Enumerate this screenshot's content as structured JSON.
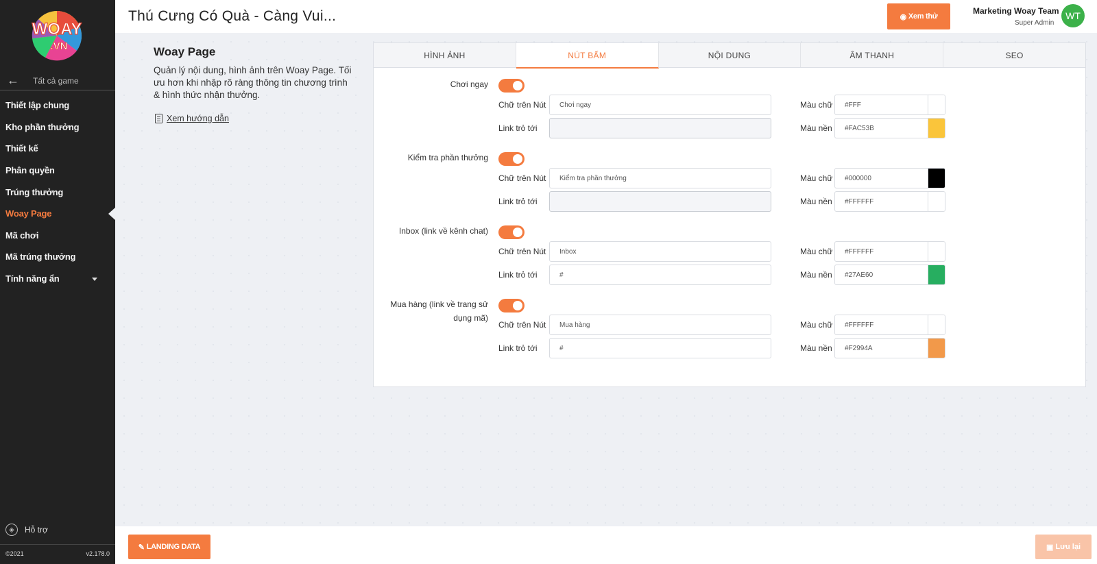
{
  "sidebar": {
    "logo_text": "WOAY",
    "logo_sub": ".VN",
    "back_label": "Tất cả game",
    "items": [
      {
        "label": "Thiết lập chung"
      },
      {
        "label": "Kho phần thưởng"
      },
      {
        "label": "Thiết kế"
      },
      {
        "label": "Phân quyền"
      },
      {
        "label": "Trúng thưởng"
      },
      {
        "label": "Woay Page"
      },
      {
        "label": "Mã chơi"
      },
      {
        "label": "Mã trúng thưởng"
      },
      {
        "label": "Tính năng ẩn"
      }
    ],
    "active_item": "Woay Page",
    "support_label": "Hỗ trợ",
    "copyright": "©2021",
    "version": "v2.178.0"
  },
  "header": {
    "title": "Thú Cưng Có Quà - Càng Vui...",
    "preview_label": "Xem thử",
    "user_name": "Marketing Woay Team",
    "user_role": "Super Admin",
    "avatar_initials": "WT"
  },
  "intro": {
    "title": "Woay Page",
    "description": "Quản lý nội dung, hình ảnh trên Woay Page. Tối ưu hơn khi nhập rõ ràng thông tin chương trình & hình thức nhận thưởng.",
    "guide_link": "Xem hướng dẫn"
  },
  "tabs": [
    {
      "label": "HÌNH ẢNH"
    },
    {
      "label": "NÚT BẤM"
    },
    {
      "label": "NỘI DUNG"
    },
    {
      "label": "ÂM THANH"
    },
    {
      "label": "SEO"
    }
  ],
  "active_tab": "NÚT BẤM",
  "field_labels": {
    "button_text": "Chữ trên Nút",
    "link": "Link trỏ tới",
    "text_color": "Màu chữ",
    "bg_color": "Màu nền"
  },
  "button_groups": [
    {
      "label": "Chơi ngay",
      "enabled": true,
      "button_text": "Chơi ngay",
      "link": "",
      "link_readonly": true,
      "text_color": "#FFF",
      "bg_color": "#FAC53B"
    },
    {
      "label": "Kiểm tra phần thưởng",
      "enabled": true,
      "button_text": "Kiểm tra phần thưởng",
      "link": "",
      "link_readonly": true,
      "text_color": "#000000",
      "bg_color": "#FFFFFF"
    },
    {
      "label": "Inbox (link về kênh chat)",
      "enabled": true,
      "button_text": "Inbox",
      "link": "#",
      "link_readonly": false,
      "text_color": "#FFFFFF",
      "bg_color": "#27AE60"
    },
    {
      "label": "Mua hàng (link về trang sử dụng mã)",
      "enabled": true,
      "button_text": "Mua hàng",
      "link": "#",
      "link_readonly": false,
      "text_color": "#FFFFFF",
      "bg_color": "#F2994A"
    }
  ],
  "footer": {
    "landing_label": "LANDING DATA",
    "save_label": "Lưu lại"
  },
  "colors": {
    "accent": "#f47b3f",
    "sidebar_bg": "#222222",
    "toggle_on": "#f47b3f"
  }
}
